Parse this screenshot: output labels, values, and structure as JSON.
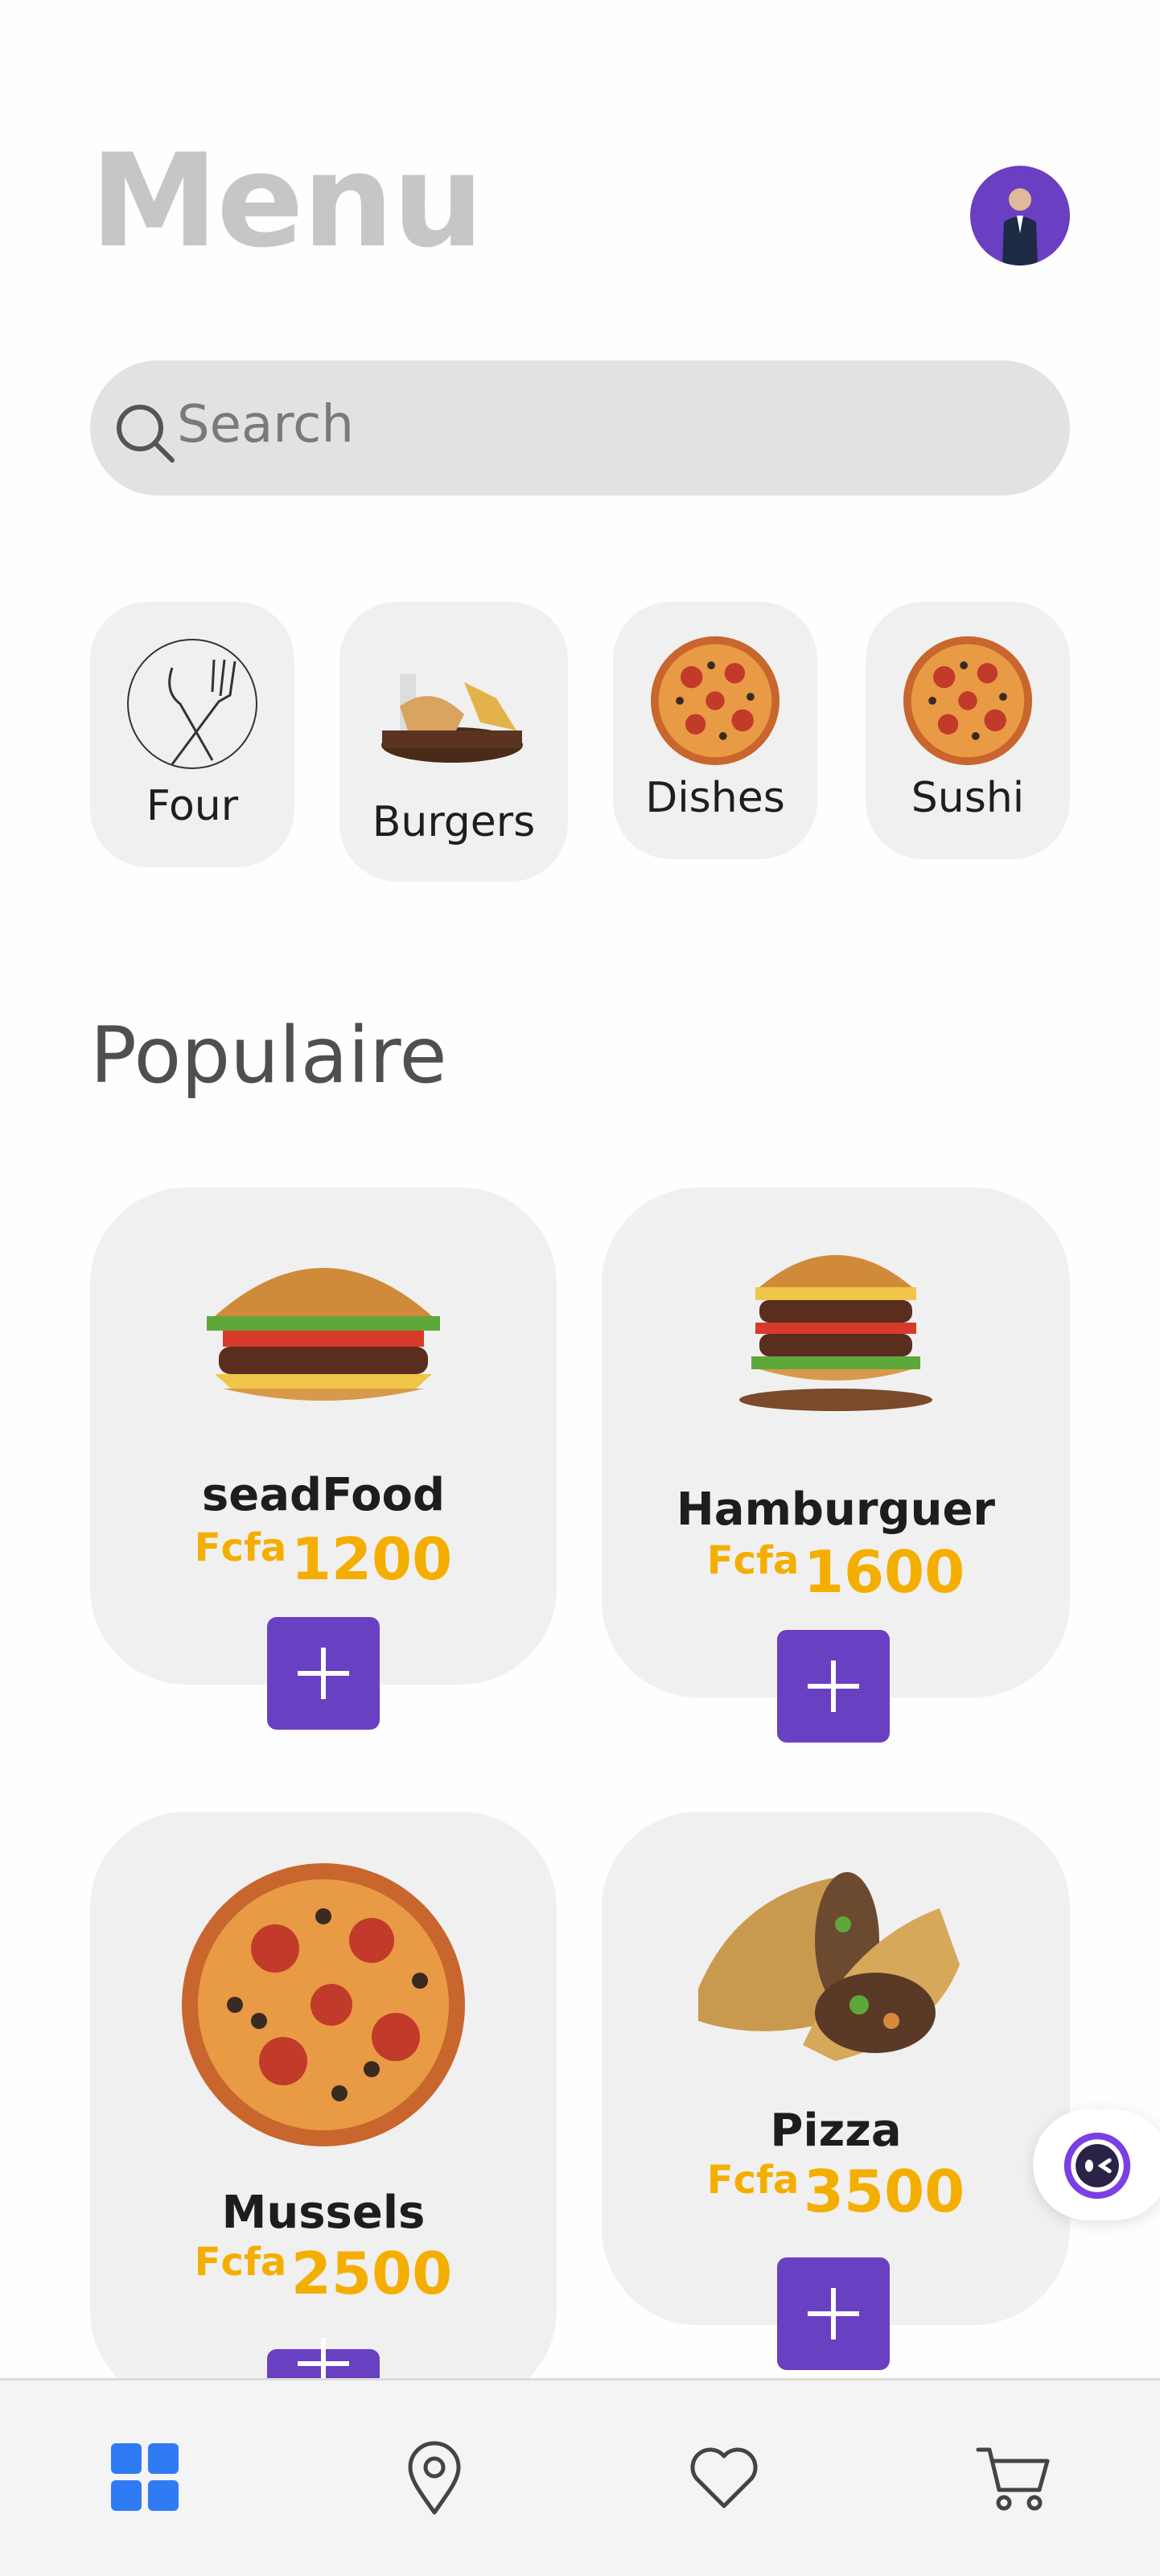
{
  "header": {
    "title": "Menu"
  },
  "search": {
    "placeholder": "Search"
  },
  "categories": [
    {
      "label": "Four"
    },
    {
      "label": "Burgers"
    },
    {
      "label": "Dishes"
    },
    {
      "label": "Sushi"
    }
  ],
  "section": {
    "title": "Populaire"
  },
  "products": [
    {
      "name": "seadFood",
      "currency": "Fcfa",
      "price": "1200"
    },
    {
      "name": "Hamburguer",
      "currency": "Fcfa",
      "price": "1600"
    },
    {
      "name": "Mussels",
      "currency": "Fcfa",
      "price": "2500"
    },
    {
      "name": "Pizza",
      "currency": "Fcfa",
      "price": "3500"
    }
  ],
  "colors": {
    "accent": "#6a40c2",
    "price": "#f4ae00",
    "nav_active": "#2f7bf4"
  },
  "nav": [
    {
      "icon": "grid-icon",
      "active": true
    },
    {
      "icon": "map-pin-icon"
    },
    {
      "icon": "heart-icon"
    },
    {
      "icon": "cart-icon"
    }
  ]
}
